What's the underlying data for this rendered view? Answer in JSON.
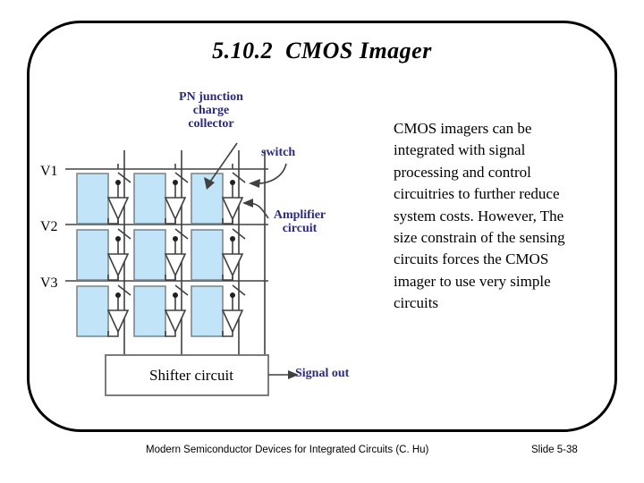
{
  "slide": {
    "title": "5.10.2  CMOS Imager",
    "frame_color": "#000000",
    "background": "#ffffff"
  },
  "annotations": {
    "accent_color": "#2B2B7F",
    "pn_junction": "PN junction\ncharge\ncollector",
    "switch": "switch",
    "amplifier": "Amplifier\ncircuit",
    "signal_out": "Signal out"
  },
  "body": {
    "paragraph": "CMOS imagers can be integrated with signal processing and control circuitries to further reduce system costs. However, The size constrain of the sensing circuits forces the CMOS imager to use very simple circuits"
  },
  "schematic": {
    "row_labels": [
      "V1",
      "V2",
      "V3"
    ],
    "shifter_label": "Shifter circuit",
    "photodiode_fill": "#C2E4F8",
    "photodiode_stroke": "#7A8A92",
    "wire_color": "#404040",
    "rows": 3,
    "columns": 3
  },
  "footer": {
    "left": "Modern Semiconductor Devices for Integrated Circuits  (C. Hu)",
    "right": "Slide 5-38"
  }
}
